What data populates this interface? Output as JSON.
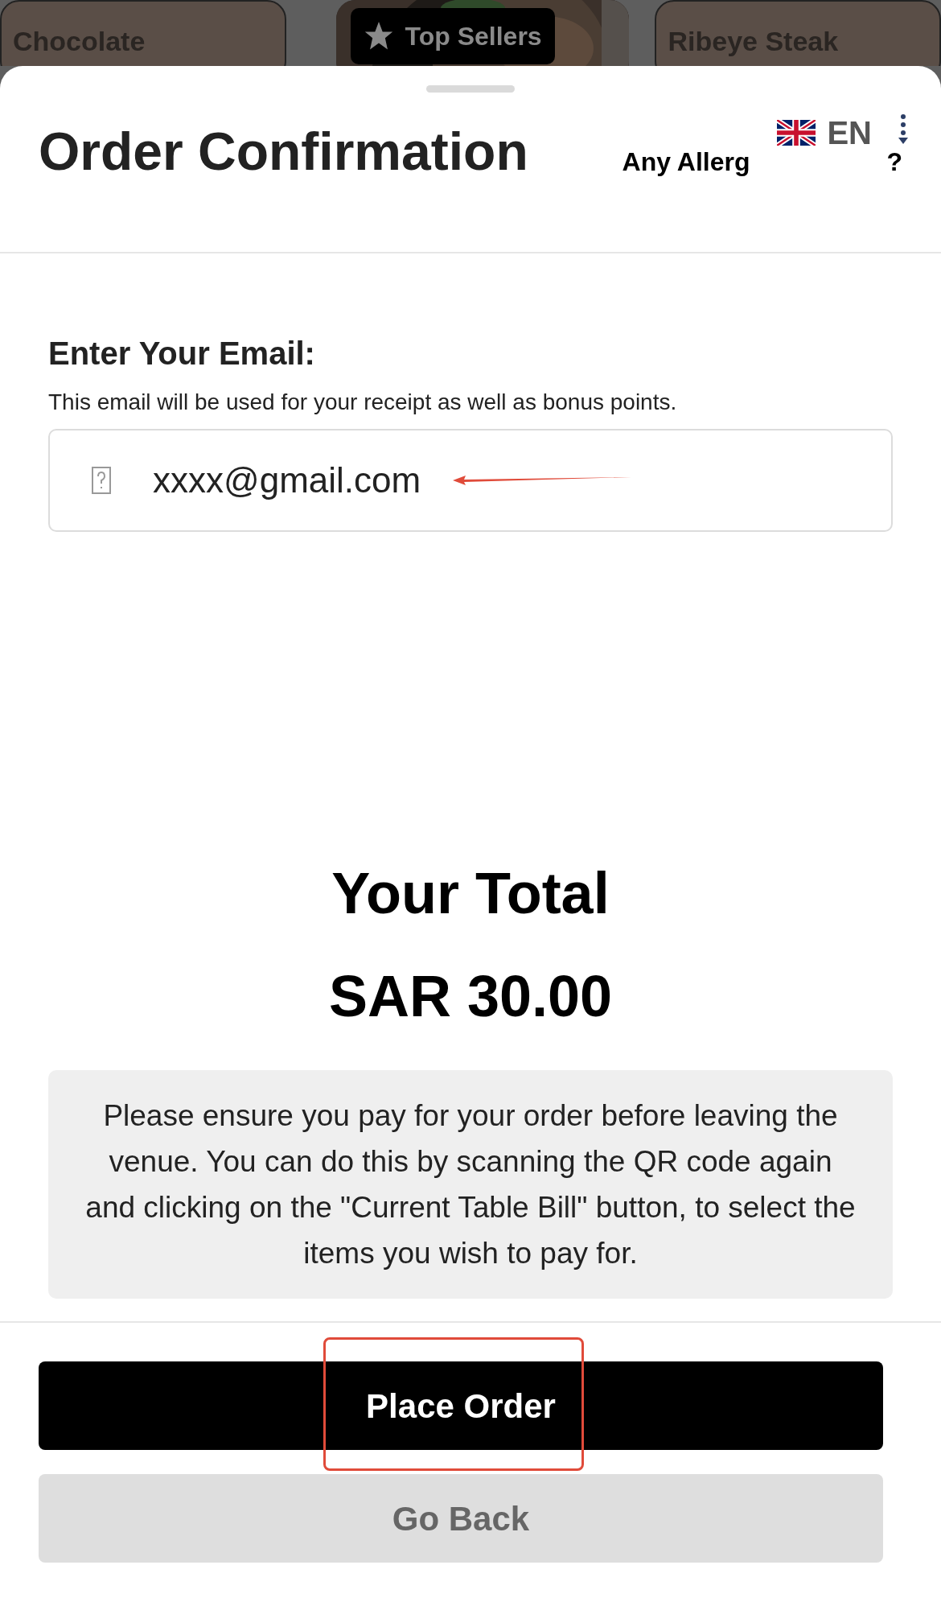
{
  "background": {
    "cards": [
      {
        "kind": "text",
        "label": "Chocolate"
      },
      {
        "kind": "picture",
        "badge": {
          "label": "Top Sellers"
        }
      },
      {
        "kind": "text",
        "label": "Ribeye Steak"
      }
    ]
  },
  "sheet": {
    "title": "Order Confirmation",
    "allergy_prompt": {
      "start": "Any Allerg",
      "end": "?"
    },
    "language": {
      "code": "EN"
    },
    "email": {
      "heading": "Enter Your Email:",
      "hint": "This email will be used for your receipt as well as bonus points.",
      "value": "xxxx@gmail.com"
    },
    "total": {
      "label": "Your Total",
      "amount": "SAR 30.00"
    },
    "notice": "Please ensure you pay for your order before leaving the venue. You can do this by scanning the QR code again and clicking on the \"Current Table Bill\" button, to select the items you wish to pay for.",
    "buttons": [
      {
        "kind": "primary",
        "label": "Place Order",
        "highlighted": true
      },
      {
        "kind": "secondary",
        "label": "Go Back",
        "highlighted": false
      }
    ]
  }
}
